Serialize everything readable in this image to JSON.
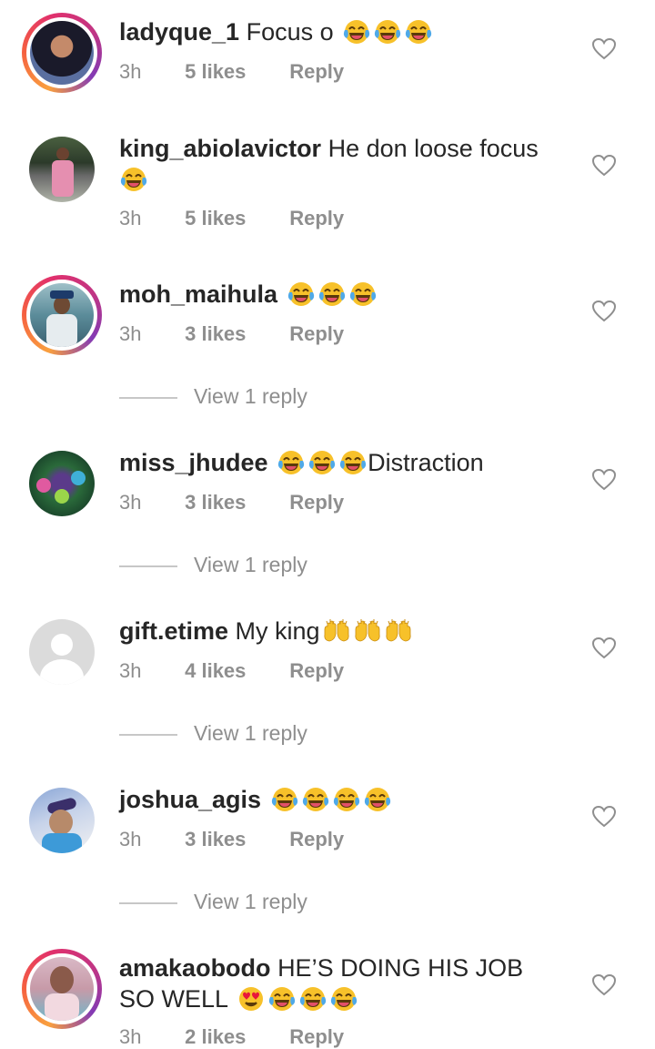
{
  "comments": [
    {
      "username": "ladyque_1",
      "text": "Focus o",
      "emoji_after": [
        "laugh",
        "laugh",
        "laugh"
      ],
      "time": "3h",
      "likes": "5 likes",
      "reply": "Reply",
      "view_replies": ""
    },
    {
      "username": "king_abiolavictor",
      "text": "He don loose focus",
      "emoji_after": [
        "laugh"
      ],
      "time": "3h",
      "likes": "5 likes",
      "reply": "Reply",
      "view_replies": ""
    },
    {
      "username": "moh_maihula",
      "text": "",
      "emoji_after": [
        "laugh",
        "laugh",
        "laugh"
      ],
      "time": "3h",
      "likes": "3 likes",
      "reply": "Reply",
      "view_replies": "View 1 reply"
    },
    {
      "username": "miss_jhudee",
      "text": "Distraction",
      "emoji_after": [
        "laugh",
        "laugh",
        "laugh"
      ],
      "time": "3h",
      "likes": "3 likes",
      "reply": "Reply",
      "view_replies": "View 1 reply"
    },
    {
      "username": "gift.etime",
      "text": "My king",
      "emoji_after": [
        "raised-hands",
        "raised-hands",
        "raised-hands"
      ],
      "time": "3h",
      "likes": "4 likes",
      "reply": "Reply",
      "view_replies": "View 1 reply"
    },
    {
      "username": "joshua_agis",
      "text": "",
      "emoji_after": [
        "laugh",
        "laugh",
        "laugh",
        "laugh"
      ],
      "time": "3h",
      "likes": "3 likes",
      "reply": "Reply",
      "view_replies": "View 1 reply"
    },
    {
      "username": "amakaobodo",
      "text": "HE’S DOING HIS JOB SO WELL",
      "emoji_after": [
        "heart-eyes",
        "laugh",
        "laugh",
        "laugh"
      ],
      "time": "3h",
      "likes": "2 likes",
      "reply": "Reply",
      "view_replies": ""
    }
  ],
  "icons": {
    "like": "heart-outline-icon",
    "laugh": "face-with-tears-of-joy-emoji",
    "raised_hands": "raised-hands-emoji",
    "heart_eyes": "heart-eyes-emoji"
  },
  "colors": {
    "text": "#262626",
    "meta": "#8e8e8e",
    "divider": "#c7c7c7",
    "story_ring": "#e1306c",
    "laugh_face": "#f7c12a"
  }
}
